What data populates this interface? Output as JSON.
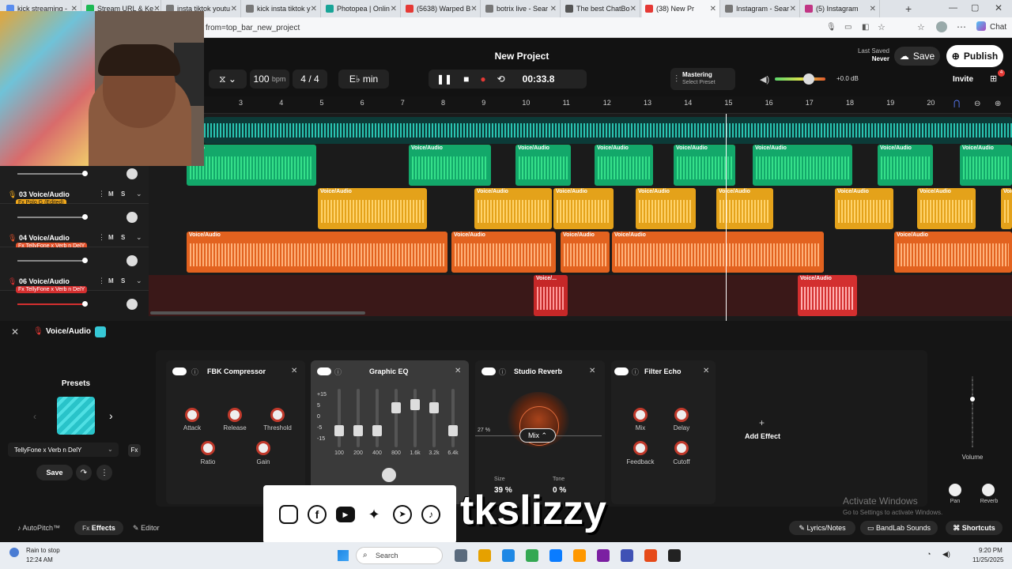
{
  "tabs": [
    {
      "label": "kick streaming -",
      "color": "#5a8dee"
    },
    {
      "label": "Stream URL & Ke",
      "color": "#1db954"
    },
    {
      "label": "insta tiktok youtu",
      "color": "#777"
    },
    {
      "label": "kick insta tiktok y",
      "color": "#777"
    },
    {
      "label": "Photopea | Onlin",
      "color": "#18a497"
    },
    {
      "label": "(5638) Warped B",
      "color": "#e53935"
    },
    {
      "label": "botrix live - Sear",
      "color": "#777"
    },
    {
      "label": "The best ChatBo",
      "color": "#555"
    },
    {
      "label": "(38) New Pr",
      "color": "#e53935"
    },
    {
      "label": "Instagram - Sear",
      "color": "#777"
    },
    {
      "label": "(5) Instagram",
      "color": "#c13584"
    }
  ],
  "url": "from=top_bar_new_project",
  "chat_label": "Chat",
  "project": {
    "title": "New Project",
    "last_saved_label": "Last Saved",
    "last_saved_value": "Never",
    "save": "Save",
    "publish": "Publish",
    "invite": "Invite",
    "badge": "4"
  },
  "transport": {
    "bpm": "100",
    "bpm_unit": "bpm",
    "sig_num": "4",
    "sig_sep": "/",
    "sig_den": "4",
    "key": "E♭ min",
    "time": "00:33.8",
    "mastering": "Mastering",
    "preset": "Select Preset",
    "gain": "+0.0 dB"
  },
  "ruler": [
    "3",
    "4",
    "5",
    "6",
    "7",
    "8",
    "9",
    "10",
    "11",
    "12",
    "13",
    "14",
    "15",
    "16",
    "17",
    "18",
    "19",
    "20"
  ],
  "tracks": [
    {
      "name": "03 Voice/Audio",
      "fx": "Fx Polo G (Edited)",
      "fxcolor": "#f0a81c"
    },
    {
      "name": "04 Voice/Audio",
      "fx": "Fx TellyFone x Verb n DelY",
      "fxcolor": "#e2522b"
    },
    {
      "name": "06 Voice/Audio",
      "fx": "Fx TellyFone x Verb n DelY",
      "fxcolor": "#d32f2f"
    }
  ],
  "track_btn_m": "M",
  "track_btn_s": "S",
  "clip_label": "Voice/Audio",
  "clip_label_short": "Voice/...",
  "clip_label_cut": "Audio",
  "fx_header": {
    "title": "Voice/Audio"
  },
  "presets": {
    "title": "Presets",
    "current": "TellyFone x Verb n DelY",
    "save": "Save"
  },
  "compressor": {
    "title": "FBK Compressor",
    "attack": "Attack",
    "release": "Release",
    "threshold": "Threshold",
    "ratio": "Ratio",
    "gain": "Gain"
  },
  "eq": {
    "title": "Graphic EQ",
    "db": [
      "+15",
      "5",
      "0",
      "-5",
      "-15"
    ],
    "bands": [
      "100",
      "200",
      "400",
      "800",
      "1.6k",
      "3.2k",
      "6.4k"
    ]
  },
  "reverb": {
    "title": "Studio Reverb",
    "pct": "27 %",
    "mix": "Mix",
    "size_label": "Size",
    "size_val": "39 %",
    "tone_label": "Tone",
    "tone_val": "0 %"
  },
  "echo": {
    "title": "Filter Echo",
    "mix": "Mix",
    "delay": "Delay",
    "feedback": "Feedback",
    "cutoff": "Cutoff"
  },
  "add_effect": "Add Effect",
  "volume": "Volume",
  "pan": "Pan",
  "reverb_knob": "Reverb",
  "activate": {
    "line1": "Activate Windows",
    "line2": "Go to Settings to activate Windows."
  },
  "bottom_tabs": {
    "autopitch": "AutoPitch™",
    "effects": "Effects",
    "editor": "Editor",
    "lyrics": "Lyrics/Notes",
    "sounds": "BandLab Sounds",
    "shortcuts": "Shortcuts"
  },
  "overlay_name": "tkslizzy",
  "taskbar": {
    "weather": "Rain to stop",
    "weather_time": "12:24 AM",
    "search": "Search",
    "time": "9:20 PM",
    "date": "11/25/2025"
  }
}
